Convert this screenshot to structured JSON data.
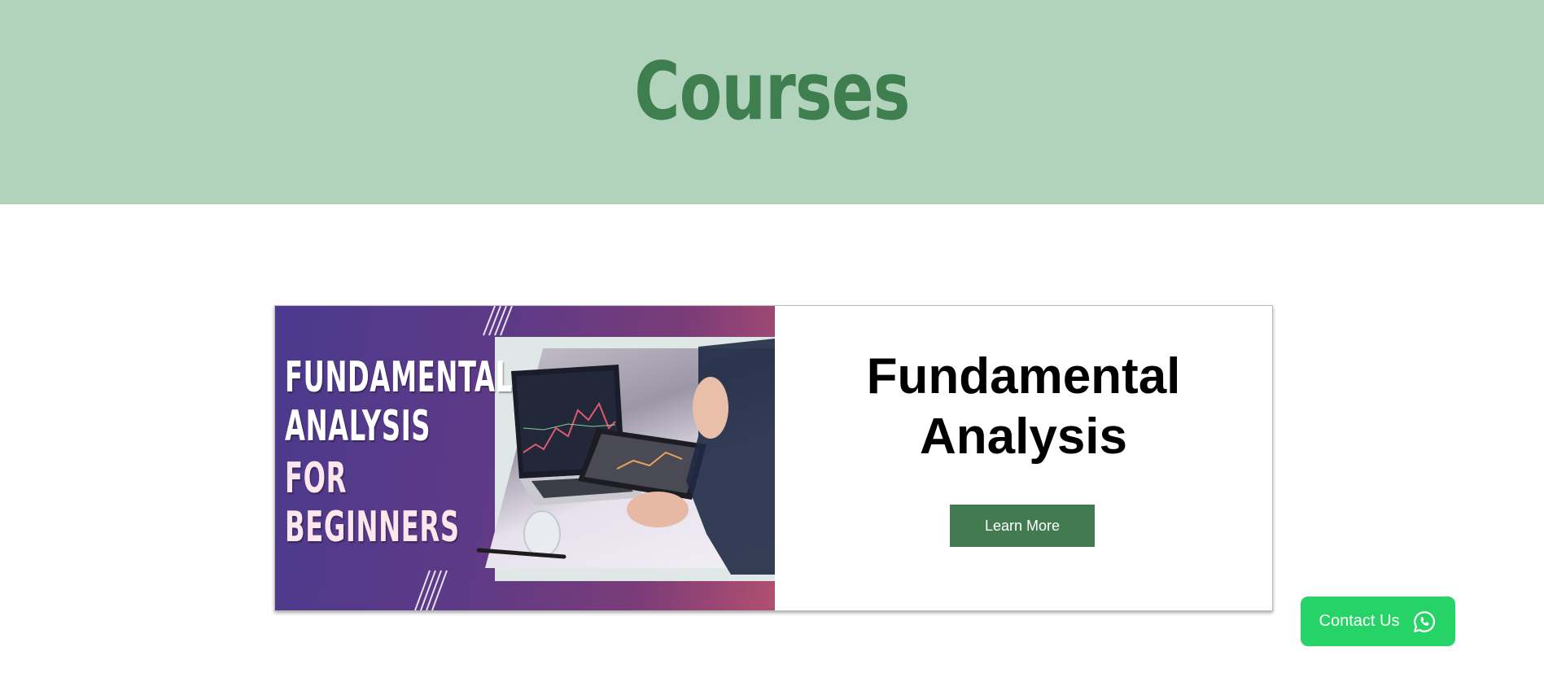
{
  "header": {
    "title": "Courses",
    "background_color": "#b1d3bb",
    "title_color": "#3f7e4f"
  },
  "course": {
    "banner": {
      "line1": "FUNDAMENTAL",
      "line2": "ANALYSIS",
      "line3": "FOR",
      "line4": "BEGINNERS"
    },
    "title_line1": "Fundamental",
    "title_line2": "Analysis",
    "button_label": "Learn More",
    "button_color": "#437b51"
  },
  "contact": {
    "label": "Contact Us",
    "icon": "whatsapp-icon",
    "color": "#25d366"
  }
}
